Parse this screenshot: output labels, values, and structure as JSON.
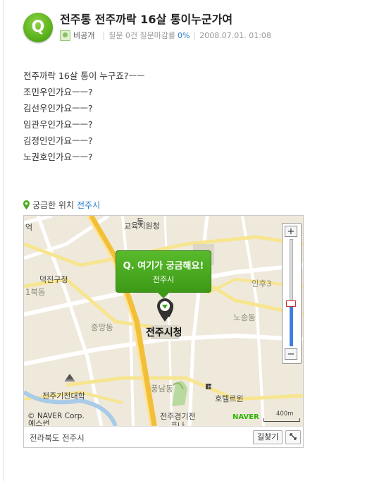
{
  "question": {
    "badge": "Q",
    "title": "전주통 전주까락 16살 통이누군가여",
    "author": "비공개",
    "stats_label": "질문 0건 질문마감률",
    "close_rate": "0%",
    "date": "2008.07.01. 01:08"
  },
  "body_lines": [
    "전주까락 16살 통이 누구죠?ㅡㅡ",
    "조민우인가요ㅡㅡ?",
    "김선우인가요ㅡㅡ?",
    "임관우인가요ㅡㅡ?",
    "김정인인가요ㅡㅡ?",
    "노권호인가요ㅡㅡ?"
  ],
  "location": {
    "label": "궁금한 위치",
    "city": "전주시"
  },
  "map": {
    "callout_title": "Q. 여기가 궁금해요!",
    "callout_city": "전주시",
    "labels": {
      "edu_office": "교육지원청",
      "deokjin_office": "덕진구청",
      "jungang": "중앙동",
      "city_hall": "전주시청",
      "nosong": "노송동",
      "inhu": "인후3",
      "pungnam": "풍남동",
      "hotel": "호텔르윈",
      "college": "전주기전대학",
      "girls_school": "전주경기전",
      "partial_a": "동",
      "partial_b": "푸나",
      "partial_c": "예스썬",
      "partial_d": "1북동",
      "partial_e": "억",
      "partial_f": "동"
    },
    "copyright": "© NAVER Corp.",
    "brand": "NAVER",
    "scale": "400m",
    "zoom_in": "+",
    "zoom_out": "−",
    "zoom_level": 0.4,
    "address": "전라북도 전주시",
    "route_button": "길찾기",
    "expand_icon": "expand-icon"
  },
  "colors": {
    "accent_green": "#5fb61f",
    "link_blue": "#2a7fd0"
  }
}
